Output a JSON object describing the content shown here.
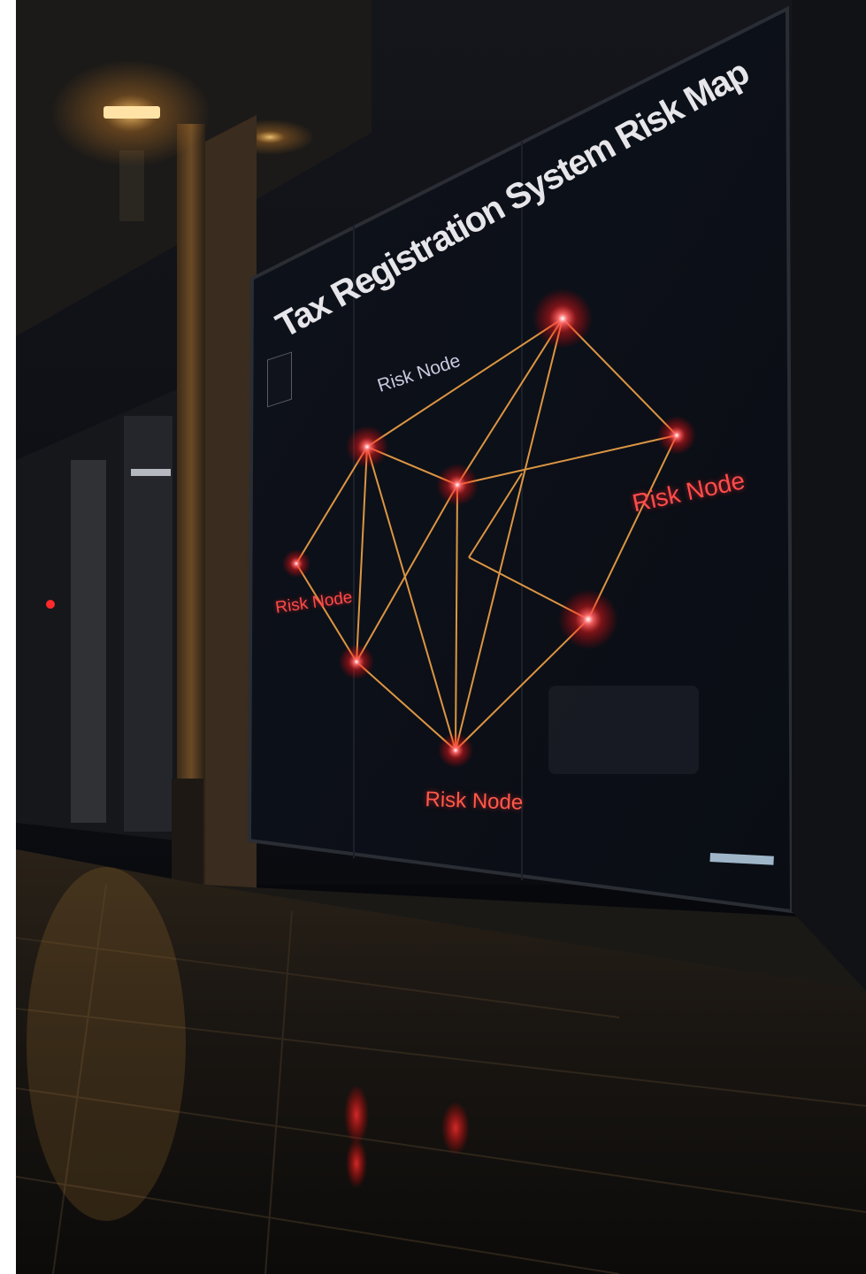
{
  "poster": {
    "title": "Tax Registration System Risk Map",
    "subtitle": "",
    "node_labels": {
      "top": "Risk Node",
      "right": "Risk Node",
      "left": "Risk Node",
      "bottom": "Risk Node"
    },
    "colors": {
      "node": "#ff2a2a",
      "edge": "#f0a040",
      "screen": "#0c1018",
      "street_light": "#ffb34a"
    }
  }
}
